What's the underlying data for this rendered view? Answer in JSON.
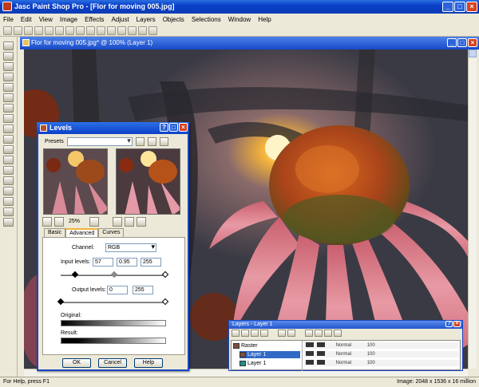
{
  "app": {
    "title": "Jasc Paint Shop Pro - [Flor for moving 005.jpg]",
    "window_buttons": [
      "_",
      "□",
      "×"
    ]
  },
  "menu": [
    "File",
    "Edit",
    "View",
    "Image",
    "Effects",
    "Adjust",
    "Layers",
    "Objects",
    "Selections",
    "Window",
    "Help"
  ],
  "document": {
    "title": "Flor for moving 005.jpg* @ 100% (Layer 1)"
  },
  "dialog": {
    "title": "Levels",
    "presets_label": "Presets",
    "presets_value": "",
    "zoom_value": "25%",
    "tabs": [
      "Basic",
      "Advanced",
      "Curves"
    ],
    "active_tab": "Advanced",
    "channel_label": "Channel:",
    "channel_value": "RGB",
    "input_levels_label": "Input levels:",
    "input_levels": [
      "57",
      "0.95",
      "255"
    ],
    "output_levels_label": "Output levels:",
    "output_levels": [
      "0",
      "255"
    ],
    "original_label": "Original:",
    "result_label": "Result:",
    "buttons": {
      "ok": "OK",
      "cancel": "Cancel",
      "help": "Help"
    }
  },
  "layers": {
    "title": "Layers - Layer 1",
    "rows": [
      {
        "name": "Raster",
        "selected": false
      },
      {
        "name": "Layer 1",
        "selected": true
      },
      {
        "name": "Layer 1",
        "selected": false
      }
    ],
    "blend_labels": [
      "Normal",
      "Normal",
      "Normal"
    ],
    "opacity_labels": [
      "100",
      "100",
      "100"
    ]
  },
  "status": {
    "left": "For Help, press F1",
    "right": "Image: 2048 x 1536 x 16 million"
  },
  "colors": {
    "titlebar_blue": "#0b41c8",
    "close_red": "#d8411e",
    "selected_row": "#316ac5",
    "tab_highlight": "#f0b43b"
  }
}
